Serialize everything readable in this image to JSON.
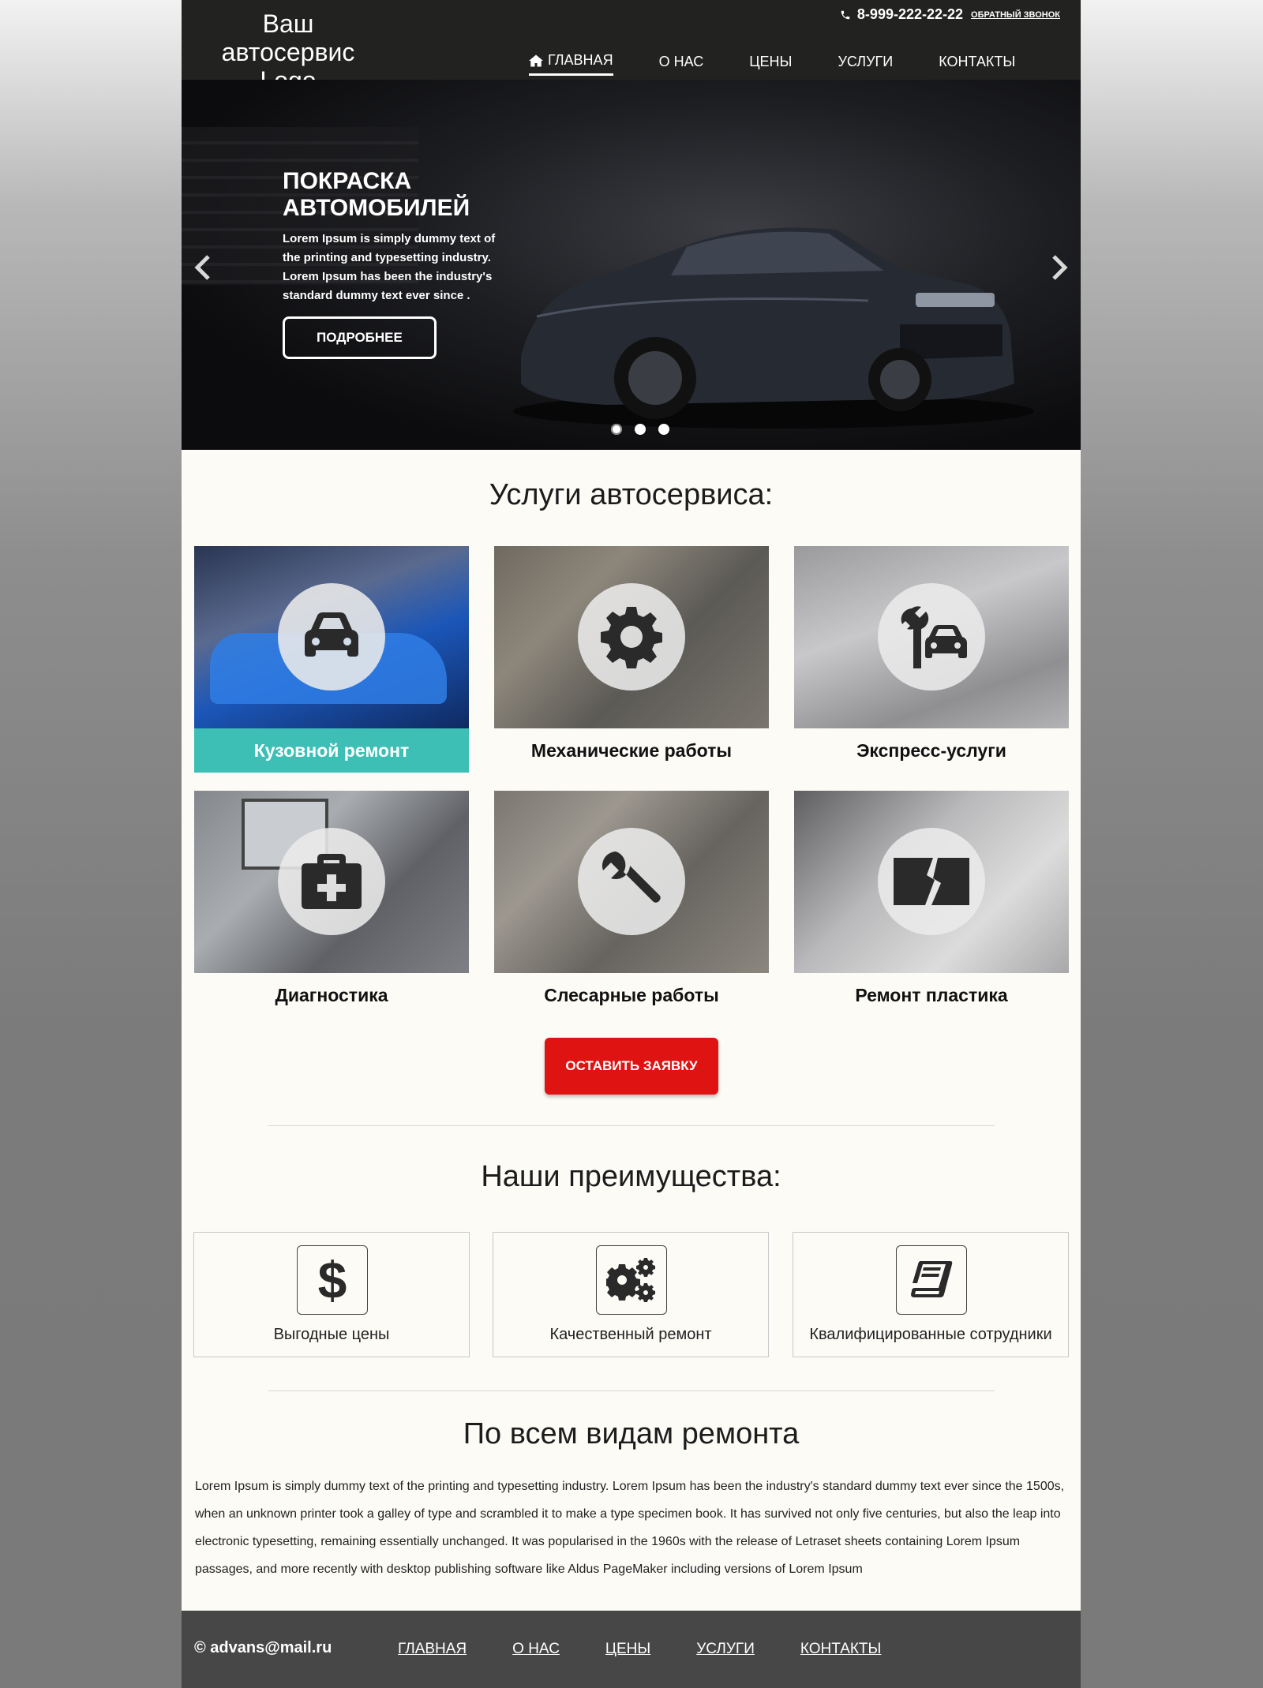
{
  "header": {
    "logo_line1": "Ваш автосервис",
    "logo_line2": "Logo",
    "phone": "8-999-222-22-22",
    "callback": "ОБРАТНЫЙ ЗВОНОК",
    "nav": [
      "ГЛАВНАЯ",
      "О НАС",
      "ЦЕНЫ",
      "УСЛУГИ",
      "КОНТАКТЫ"
    ],
    "active_nav": "ГЛАВНАЯ"
  },
  "hero": {
    "title": "ПОКРАСКА АВТОМОБИЛЕЙ",
    "description": "Lorem Ipsum is simply dummy text of the printing and typesetting industry. Lorem Ipsum has been the industry's standard dummy text ever since .",
    "button": "ПОДРОБНЕЕ",
    "slides": 3,
    "active_slide": 1
  },
  "services": {
    "title": "Услуги автосервиса:",
    "items": [
      {
        "label": "Кузовной ремонт",
        "icon": "car-icon",
        "active": true
      },
      {
        "label": "Механические работы",
        "icon": "gear-icon",
        "active": false
      },
      {
        "label": "Экспресс-услуги",
        "icon": "wrench-car-icon",
        "active": false
      },
      {
        "label": "Диагностика",
        "icon": "medkit-icon",
        "active": false
      },
      {
        "label": "Слесарные работы",
        "icon": "wrench-icon",
        "active": false
      },
      {
        "label": "Ремонт пластика",
        "icon": "broken-plastic-icon",
        "active": false
      }
    ],
    "order_button": "ОСТАВИТЬ ЗАЯВКУ"
  },
  "advantages": {
    "title": "Наши преимущества:",
    "items": [
      {
        "label": "Выгодные цены",
        "icon": "dollar-icon"
      },
      {
        "label": "Качественный ремонт",
        "icon": "gears-icon"
      },
      {
        "label": "Квалифицированные сотрудники",
        "icon": "book-icon"
      }
    ]
  },
  "about": {
    "title": "По всем видам ремонта",
    "text": "Lorem Ipsum is simply dummy text of the printing and typesetting industry. Lorem Ipsum has been the industry's standard dummy text ever since the 1500s, when an unknown printer took a galley of type and scrambled it to make a type specimen book. It has survived not only five centuries, but also the leap into electronic typesetting, remaining essentially unchanged. It was popularised in the 1960s with the release of Letraset sheets containing Lorem Ipsum passages, and more recently with desktop publishing software like Aldus PageMaker including versions of Lorem Ipsum"
  },
  "footer": {
    "email": "© advans@mail.ru",
    "nav": [
      "ГЛАВНАЯ",
      "О НАС",
      "ЦЕНЫ",
      "УСЛУГИ",
      "КОНТАКТЫ"
    ]
  },
  "colors": {
    "accent": "#3dbfb5",
    "order_button": "#e01313",
    "header_bg": "#222220",
    "footer_bg": "#474747"
  }
}
